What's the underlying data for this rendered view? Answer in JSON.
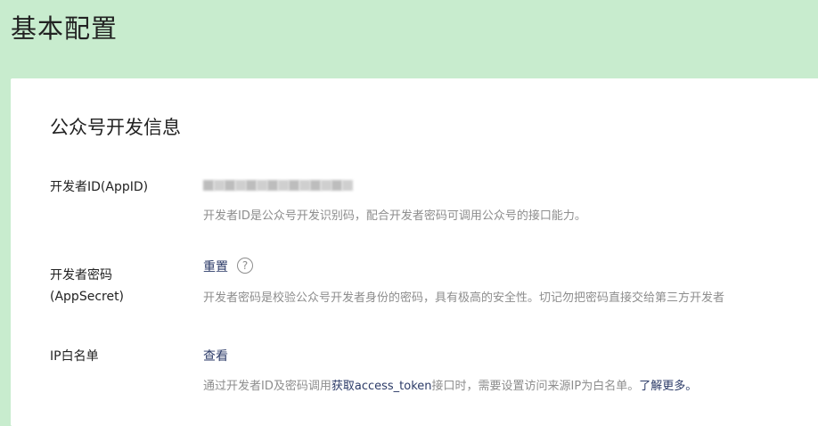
{
  "header": {
    "title": "基本配置"
  },
  "section": {
    "title": "公众号开发信息"
  },
  "rows": {
    "appid": {
      "label": "开发者ID(AppID)",
      "description": "开发者ID是公众号开发识别码，配合开发者密码可调用公众号的接口能力。"
    },
    "appsecret": {
      "label_line1": "开发者密码",
      "label_line2": "(AppSecret)",
      "action": "重置",
      "help_glyph": "?",
      "description": "开发者密码是校验公众号开发者身份的密码，具有极高的安全性。切记勿把密码直接交给第三方开发者"
    },
    "ip_whitelist": {
      "label": "IP白名单",
      "action": "查看",
      "desc_prefix": "通过开发者ID及密码调用",
      "desc_link": "获取access_token",
      "desc_middle": "接口时，需要设置访问来源IP为白名单。",
      "desc_more_link": "了解更多。"
    }
  },
  "colors": {
    "background": "#c8ecce",
    "panel": "#ffffff",
    "link": "#2b3a67",
    "muted": "#8d8d8d"
  }
}
